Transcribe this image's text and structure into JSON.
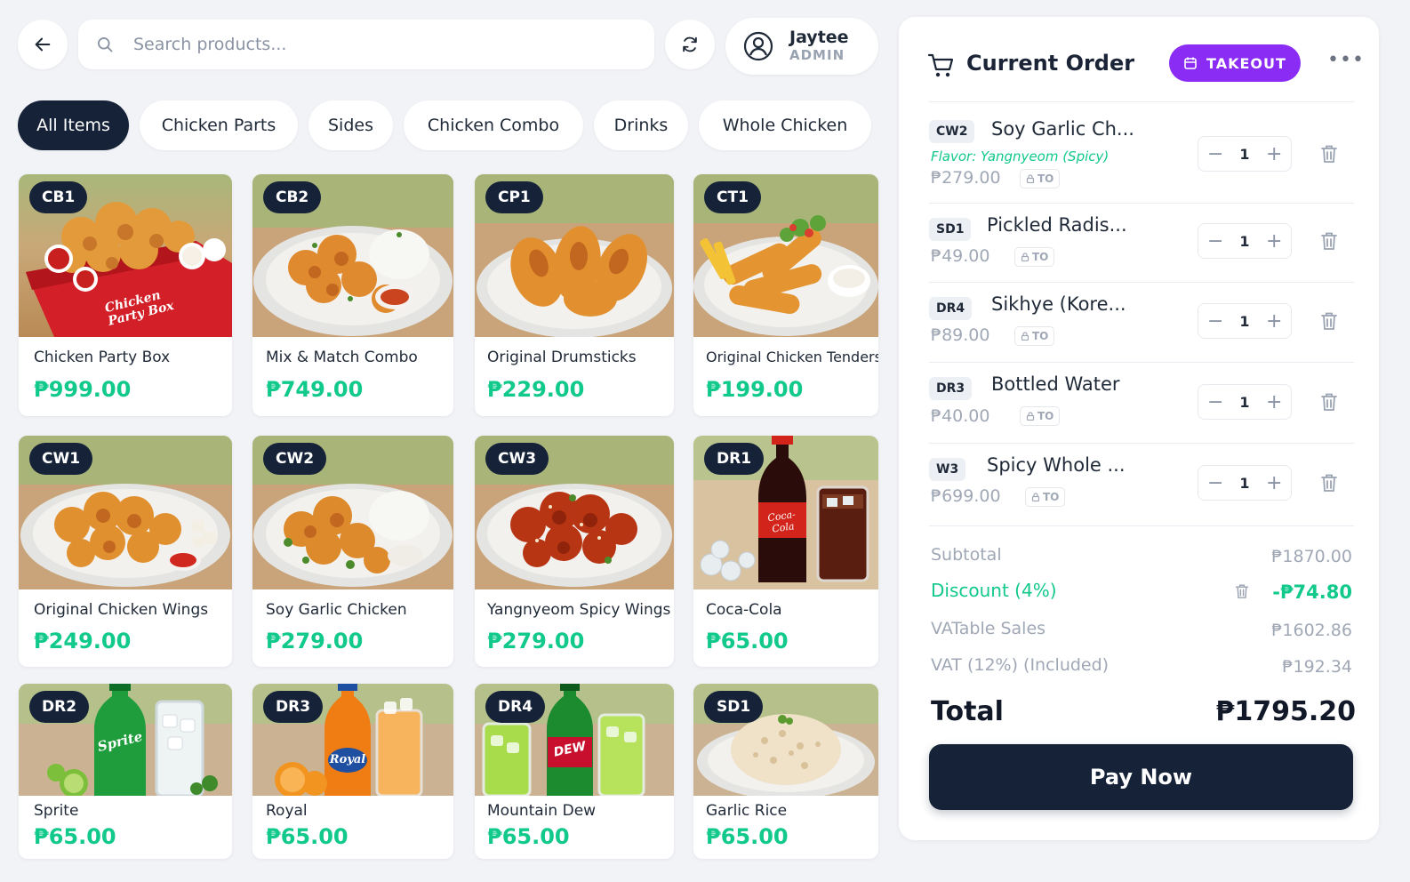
{
  "header": {
    "search_placeholder": "Search products...",
    "user": {
      "name": "Jaytee",
      "role": "ADMIN"
    }
  },
  "categories": [
    {
      "label": "All Items",
      "active": true
    },
    {
      "label": "Chicken Parts",
      "active": false
    },
    {
      "label": "Sides",
      "active": false
    },
    {
      "label": "Chicken Combo",
      "active": false
    },
    {
      "label": "Drinks",
      "active": false
    },
    {
      "label": "Whole Chicken",
      "active": false
    }
  ],
  "products": [
    {
      "code": "CB1",
      "name": "Chicken Party Box",
      "price": "₱999.00",
      "box_text": "Chicken Party Box"
    },
    {
      "code": "CB2",
      "name": "Mix & Match Combo",
      "price": "₱749.00"
    },
    {
      "code": "CP1",
      "name": "Original Drumsticks",
      "price": "₱229.00"
    },
    {
      "code": "CT1",
      "name": "Original Chicken Tenders",
      "price": "₱199.00"
    },
    {
      "code": "CW1",
      "name": "Original Chicken Wings",
      "price": "₱249.00"
    },
    {
      "code": "CW2",
      "name": "Soy Garlic Chicken",
      "price": "₱279.00"
    },
    {
      "code": "CW3",
      "name": "Yangnyeom Spicy Wings",
      "price": "₱279.00"
    },
    {
      "code": "DR1",
      "name": "Coca-Cola",
      "price": "₱65.00",
      "bottle_text": "Coca-Cola"
    },
    {
      "code": "DR2",
      "name": "Sprite",
      "price": "₱65.00",
      "bottle_text": "Sprite"
    },
    {
      "code": "DR3",
      "name": "Royal",
      "price": "₱65.00",
      "bottle_text": "Royal"
    },
    {
      "code": "DR4",
      "name": "Mountain Dew",
      "price": "₱65.00",
      "bottle_text": "DEW"
    },
    {
      "code": "SD1",
      "name": "Garlic Rice",
      "price": "₱65.00"
    }
  ],
  "order": {
    "title": "Current Order",
    "mode_label": "TAKEOUT",
    "more_label": "•••",
    "items": [
      {
        "code": "CW2",
        "name": "Soy Garlic Ch...",
        "flavor": "Flavor: Yangnyeom (Spicy)",
        "price": "₱279.00",
        "tag": "TO",
        "qty": "1"
      },
      {
        "code": "SD1",
        "name": "Pickled Radis...",
        "price": "₱49.00",
        "tag": "TO",
        "qty": "1"
      },
      {
        "code": "DR4",
        "name": "Sikhye (Kore...",
        "price": "₱89.00",
        "tag": "TO",
        "qty": "1"
      },
      {
        "code": "DR3",
        "name": "Bottled Water",
        "price": "₱40.00",
        "tag": "TO",
        "qty": "1"
      },
      {
        "code": "W3",
        "name": "Spicy Whole ...",
        "price": "₱699.00",
        "tag": "TO",
        "qty": "1"
      }
    ],
    "summary": {
      "subtotal_label": "Subtotal",
      "subtotal": "₱1870.00",
      "discount_label": "Discount (4%)",
      "discount": "-₱74.80",
      "vatable_label": "VATable Sales",
      "vatable": "₱1602.86",
      "vat_label": "VAT (12%) (Included)",
      "vat": "₱192.34",
      "total_label": "Total",
      "total": "₱1795.20"
    },
    "pay_label": "Pay Now"
  },
  "colors": {
    "navy": "#152238",
    "accent_green": "#10c98a",
    "takeout_purple": "#8b2cf5",
    "background": "#f1f3f7"
  },
  "icons": [
    "back-arrow-icon",
    "search-icon",
    "refresh-icon",
    "user-icon",
    "cart-icon",
    "calendar-icon",
    "lock-icon",
    "trash-icon"
  ]
}
